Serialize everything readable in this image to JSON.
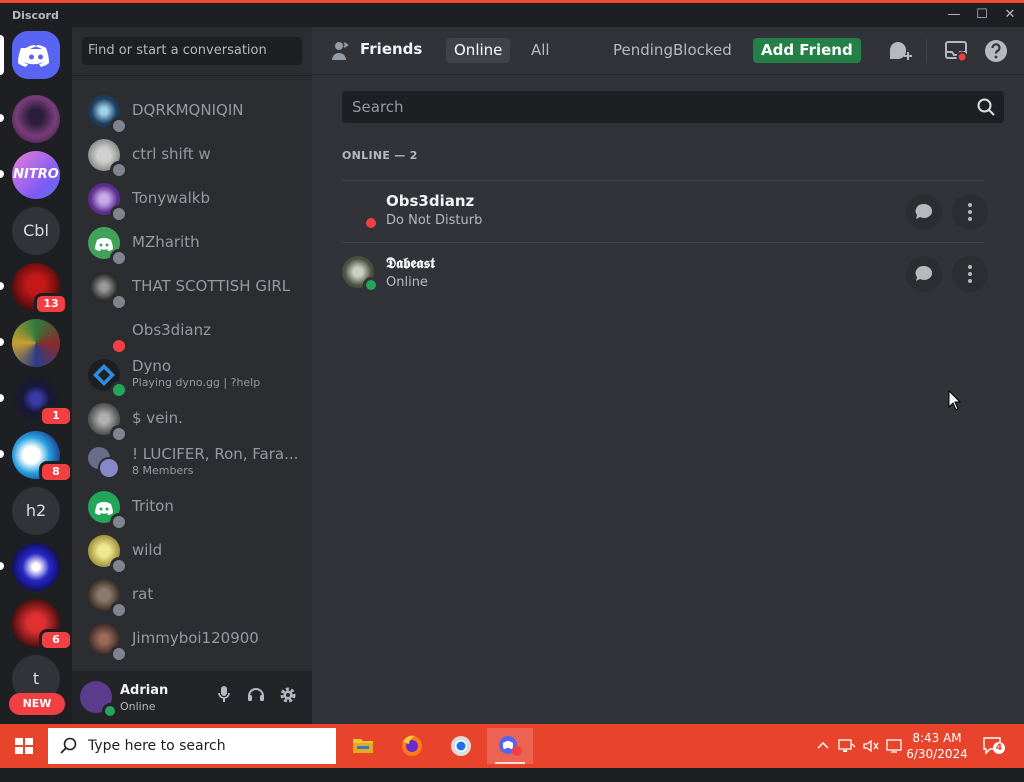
{
  "window": {
    "app_title": "Discord",
    "controls": [
      "minimize",
      "maximize",
      "close"
    ]
  },
  "rail": {
    "servers": [
      {
        "name": "home",
        "icon": "discord-logo-icon"
      },
      {
        "name": "server-1",
        "color": "#7a3e7a"
      },
      {
        "name": "nitro",
        "label": "NITRO"
      },
      {
        "name": "server-cbl",
        "label": "Cbl"
      },
      {
        "name": "server-4",
        "badge": "13"
      },
      {
        "name": "server-5"
      },
      {
        "name": "server-6",
        "badge": "1"
      },
      {
        "name": "server-7",
        "badge": "8"
      },
      {
        "name": "server-h2",
        "label": "h2"
      },
      {
        "name": "server-9"
      },
      {
        "name": "server-10",
        "badge": "6"
      },
      {
        "name": "server-t",
        "label": "t"
      }
    ],
    "new_badge": "NEW"
  },
  "sidebar": {
    "search_placeholder": "Find or start a conversation",
    "dms": [
      {
        "name": "DQRKMQNIQIN",
        "status": "offline"
      },
      {
        "name": "ctrl shift w",
        "status": "offline"
      },
      {
        "name": "Tonywalkb",
        "status": "offline"
      },
      {
        "name": "MZharith",
        "status": "offline"
      },
      {
        "name": "THAT SCOTTISH GIRL",
        "status": "offline"
      },
      {
        "name": "Obs3dianz",
        "status": "dnd"
      },
      {
        "name": "Dyno",
        "sub": "Playing dyno.gg | ?help",
        "status": "online"
      },
      {
        "name": "$ vein.",
        "status": "offline"
      },
      {
        "name": "! LUCIFER, Ron, Fara...",
        "sub": "8 Members",
        "status": "none"
      },
      {
        "name": "Triton",
        "status": "offline"
      },
      {
        "name": "wild",
        "status": "offline"
      },
      {
        "name": "rat",
        "status": "offline"
      },
      {
        "name": "Jimmyboi120900",
        "status": "offline"
      }
    ]
  },
  "user_panel": {
    "username": "Adrian",
    "status": "Online"
  },
  "header": {
    "title": "Friends",
    "tabs": {
      "online": "Online",
      "all": "All",
      "pending": "Pending",
      "blocked": "Blocked",
      "add_friend": "Add Friend"
    }
  },
  "friends": {
    "search_placeholder": "Search",
    "section_header": "ONLINE — 2",
    "list": [
      {
        "name": "Obs3dianz",
        "status_text": "Do Not Disturb",
        "status": "dnd"
      },
      {
        "name": "𝕯𝖆𝖇𝖊𝖆𝖘𝖙",
        "status_text": "Online",
        "status": "online"
      }
    ]
  },
  "taskbar": {
    "search_placeholder": "Type here to search",
    "clock_time": "8:43 AM",
    "clock_date": "6/30/2024",
    "notification_count": "4"
  },
  "colors": {
    "accent": "#5865f2",
    "online": "#23a55a",
    "dnd": "#f23f43",
    "add_friend": "#248046",
    "taskbar": "#e8432b"
  }
}
